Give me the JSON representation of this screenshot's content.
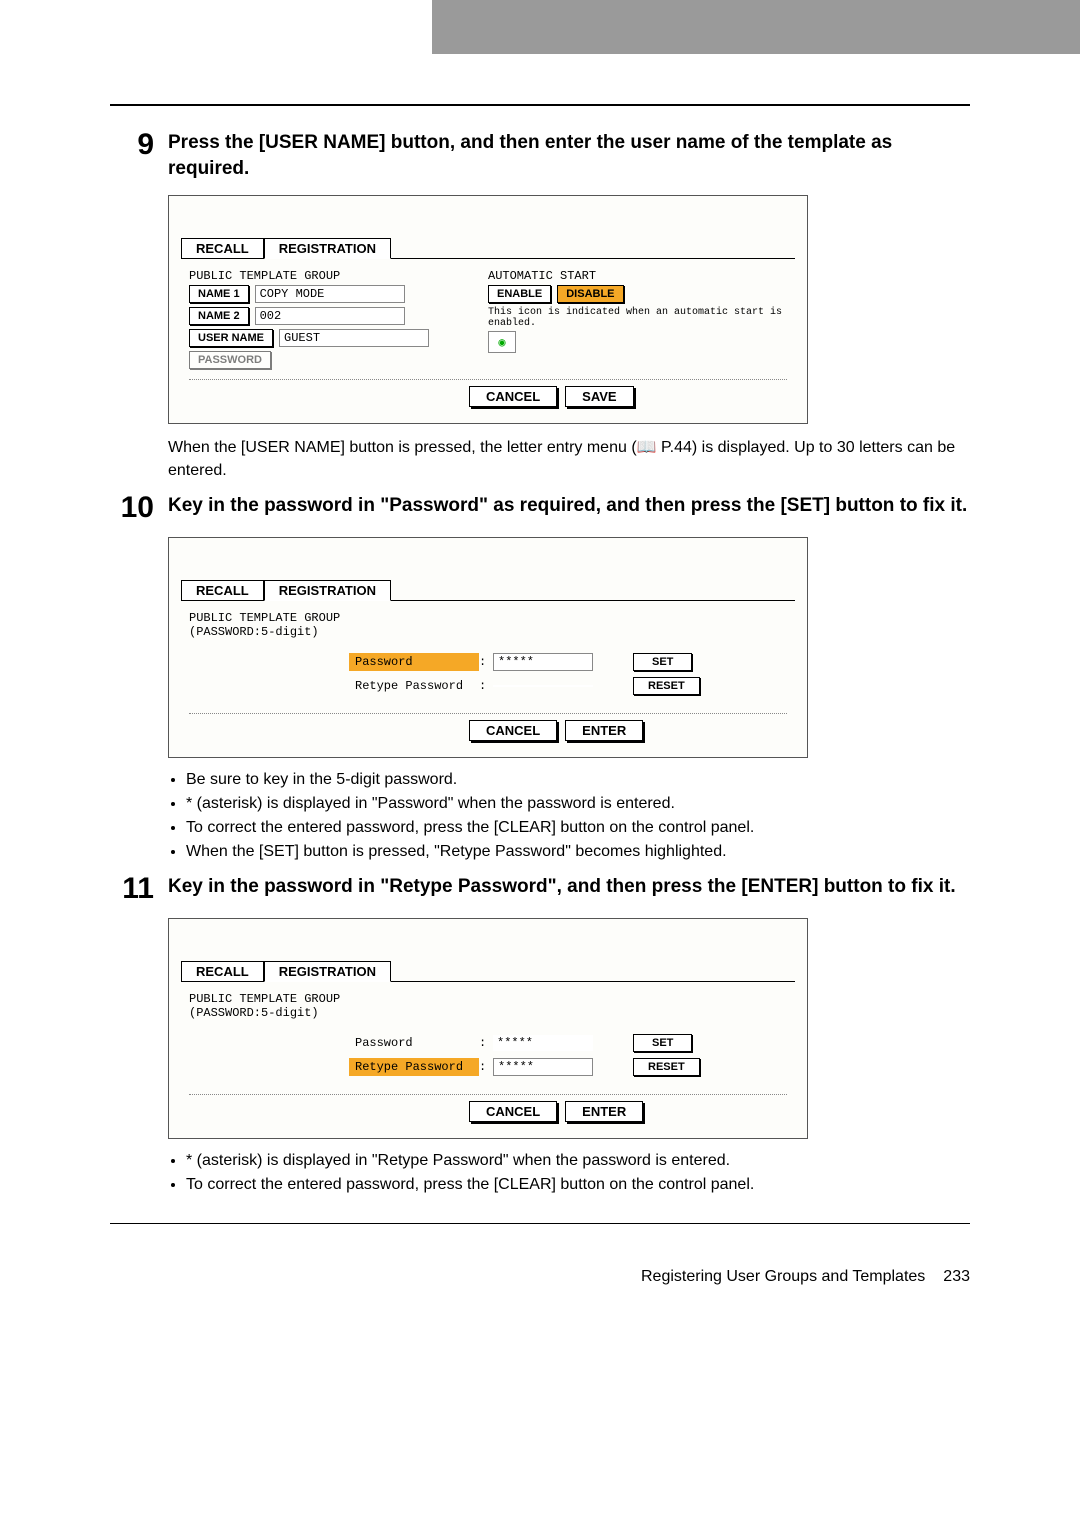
{
  "step9": {
    "num": "9",
    "text": "Press the [USER NAME] button, and then enter the user name of the template as required.",
    "sub": "When the [USER NAME] button is pressed, the letter entry menu (📖 P.44) is displayed. Up to 30 letters can be entered."
  },
  "step10": {
    "num": "10",
    "text": "Key in the password in \"Password\" as required, and then press the [SET] button to fix it.",
    "bullets": [
      "Be sure to key in the 5-digit password.",
      " * (asterisk) is displayed in \"Password\" when the password is entered.",
      "To correct the entered password, press the [CLEAR] button on the control panel.",
      "When the [SET] button is pressed, \"Retype Password\" becomes highlighted."
    ]
  },
  "step11": {
    "num": "11",
    "text": "Key in the password in \"Retype Password\", and then press the [ENTER] button to fix it.",
    "bullets": [
      "* (asterisk) is displayed in \"Retype Password\" when the password is entered.",
      "To correct the entered password, press the [CLEAR] button on the control panel."
    ]
  },
  "panel": {
    "tabs": {
      "recall": "RECALL",
      "registration": "REGISTRATION"
    },
    "group_label": "PUBLIC TEMPLATE GROUP",
    "name1_btn": "NAME 1",
    "name1_val": "COPY MODE",
    "name2_btn": "NAME 2",
    "name2_val": "002",
    "username_btn": "USER NAME",
    "username_val": "GUEST",
    "password_btn": "PASSWORD",
    "auto_start": "AUTOMATIC START",
    "enable": "ENABLE",
    "disable": "DISABLE",
    "auto_note": "This icon is indicated when an automatic start is enabled.",
    "cancel": "CANCEL",
    "save": "SAVE",
    "enter": "ENTER",
    "set": "SET",
    "reset": "RESET",
    "pw_sub": "(PASSWORD:5-digit)",
    "pw_label": "Password",
    "retype_label": "Retype Password",
    "mask": "*****"
  },
  "footer": {
    "title": "Registering User Groups and Templates",
    "page": "233"
  }
}
